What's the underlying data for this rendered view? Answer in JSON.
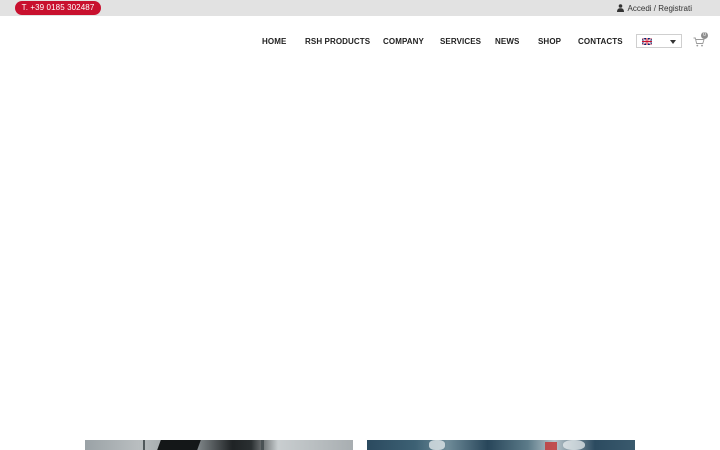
{
  "topbar": {
    "phone": "T. +39 0185 302487",
    "account_label": "Accedi / Registrati",
    "account_icon": "user-icon"
  },
  "nav": {
    "items": [
      {
        "label": "HOME"
      },
      {
        "label": "RSH PRODUCTS"
      },
      {
        "label": "COMPANY"
      },
      {
        "label": "SERVICES"
      },
      {
        "label": "NEWS"
      },
      {
        "label": "SHOP"
      },
      {
        "label": "CONTACTS"
      }
    ],
    "language": {
      "flag_icon": "uk-flag-icon",
      "dropdown_icon": "caret-down-icon"
    },
    "cart": {
      "icon": "cart-icon",
      "count": "0"
    }
  },
  "colors": {
    "accent": "#c8102e",
    "topbar_bg": "#e2e2e2",
    "nav_text": "#222222",
    "badge_bg": "#8e8e8e"
  }
}
